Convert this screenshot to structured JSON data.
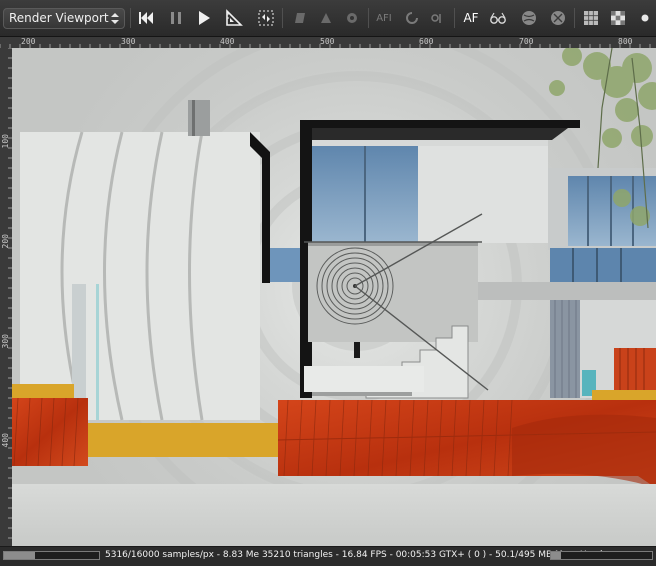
{
  "toolbar": {
    "view_selector": {
      "selected": "Render Viewport"
    },
    "buttons": [
      {
        "name": "reset-render-button",
        "icon": "skip-to-start-icon"
      },
      {
        "name": "pause-render-button",
        "icon": "pause-icon"
      },
      {
        "name": "start-render-button",
        "icon": "play-icon"
      },
      {
        "name": "set-focus-button",
        "icon": "focus-tool-icon"
      },
      {
        "name": "region-render-button",
        "icon": "region-select-icon"
      },
      {
        "name": "clay-render-button",
        "icon": "clay-icon"
      },
      {
        "name": "subsample-button",
        "icon": "subsample-icon"
      },
      {
        "name": "auto-focus-button",
        "label": "AF"
      },
      {
        "name": "grid-button",
        "icon": "grid-icon"
      },
      {
        "name": "alpha-checker-button",
        "icon": "checkerboard-icon"
      }
    ],
    "af_label": "AF",
    "afi_label": "AFI"
  },
  "ruler": {
    "top_ticks": [
      "200",
      "300",
      "400",
      "500",
      "600",
      "700",
      "800"
    ],
    "left_ticks": [
      "100",
      "200",
      "300",
      "400"
    ]
  },
  "status": {
    "text": "5316/16000 samples/px - 8.83 Me 35210 triangles - 16.84 FPS - 00:05:53 GTX+ ( 0 ) - 50.1/495 MB Mem Used",
    "sample_progress": 0.33,
    "memory_progress": 0.1
  },
  "colors": {
    "toolbar_bg": "#333333",
    "viewport_bg": "#d2d4d2",
    "accent_orange": "#cc3a12",
    "accent_yellow": "#d9a52a",
    "glass_blue": "#6e96bb"
  }
}
